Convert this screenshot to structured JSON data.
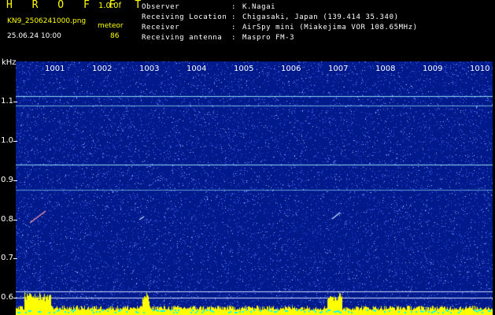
{
  "header": {
    "title": "H R O F F T",
    "version": "1.0.0f",
    "filename": "KN9_2506241000.png",
    "meteor_label": "meteor",
    "timestamp": "25.06.24 10:00",
    "meteor_count": "86"
  },
  "info": [
    {
      "key": "Observer",
      "sep": ":",
      "value": "K.Nagai"
    },
    {
      "key": "Receiving Location",
      "sep": ":",
      "value": "Chigasaki, Japan (139.414 35.340)"
    },
    {
      "key": "Receiver",
      "sep": ":",
      "value": "AirSpy mini (Miakejima VOR 108.65MHz)"
    },
    {
      "key": "Receiving antenna",
      "sep": ":",
      "value": "Maspro FM-3"
    }
  ],
  "axis": {
    "y_unit": "kHz",
    "y_ticks": [
      "1.1",
      "1.0",
      "0.9",
      "0.8",
      "0.7",
      "0.6"
    ],
    "x_ticks": [
      "1001",
      "1002",
      "1003",
      "1004",
      "1005",
      "1006",
      "1007",
      "1008",
      "1009",
      "1010"
    ]
  },
  "colors": {
    "text_header": "#ffff00",
    "text_info": "#ffffff",
    "text_ts": "#ffffff",
    "background": "#000000",
    "plot_bg": "#001a8c",
    "noise": "#5f7fff",
    "carrier": "#9fefff",
    "bar_yellow": "#ffff00",
    "bar_cyan": "#00ffff",
    "tick": "#ffffff"
  }
}
